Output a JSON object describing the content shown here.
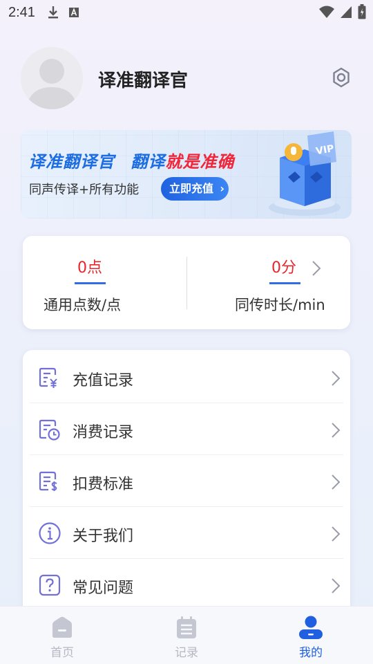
{
  "status_bar": {
    "time": "2:41"
  },
  "profile": {
    "username": "译准翻译官"
  },
  "banner": {
    "title_part1": "译准翻译官",
    "title_part2": "翻译",
    "title_part3": "就是准确",
    "subtitle": "同声传译+所有功能",
    "button_label": "立即充值",
    "badge_text": "VIP",
    "colors": {
      "blue": "#1d6de2",
      "red": "#f0263a"
    }
  },
  "stats": {
    "points_value": "0点",
    "points_label": "通用点数/点",
    "duration_value": "0分",
    "duration_label": "同传时长/min"
  },
  "menu": {
    "items": [
      {
        "label": "充值记录",
        "icon": "recharge-record-icon"
      },
      {
        "label": "消费记录",
        "icon": "consumption-record-icon"
      },
      {
        "label": "扣费标准",
        "icon": "billing-standard-icon"
      },
      {
        "label": "关于我们",
        "icon": "info-icon"
      },
      {
        "label": "常见问题",
        "icon": "question-icon"
      }
    ]
  },
  "tabbar": {
    "tabs": [
      {
        "label": "首页",
        "icon": "home-icon"
      },
      {
        "label": "记录",
        "icon": "notepad-icon"
      },
      {
        "label": "我的",
        "icon": "user-icon"
      }
    ],
    "active_index": 2,
    "active_color": "#2060e0"
  }
}
